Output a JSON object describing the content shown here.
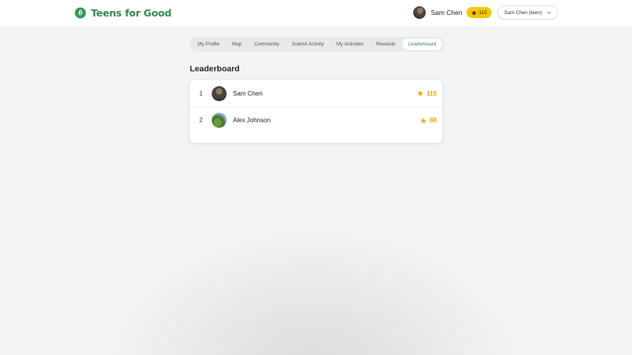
{
  "header": {
    "brand_name": "Teens for Good",
    "user_name": "Sam Chen",
    "user_points": "115",
    "user_selector_value": "Sam Chen (teen)"
  },
  "nav": {
    "tabs": [
      {
        "label": "My Profile"
      },
      {
        "label": "Map"
      },
      {
        "label": "Community"
      },
      {
        "label": "Submit Activity"
      },
      {
        "label": "My Activities"
      },
      {
        "label": "Rewards"
      },
      {
        "label": "Leaderboard"
      }
    ],
    "active_tab": "Leaderboard"
  },
  "page": {
    "title": "Leaderboard"
  },
  "leaderboard": {
    "entries": [
      {
        "rank": "1",
        "name": "Sam Chen",
        "points": "115"
      },
      {
        "rank": "2",
        "name": "Alex Johnson",
        "points": "88"
      }
    ]
  },
  "colors": {
    "brand_green": "#2f8a4e",
    "points_gold": "#f7c600",
    "points_text": "#e2a400"
  },
  "icons": {
    "brand": "leaf-icon",
    "points": "star-icon",
    "select": "chevron-down-icon"
  }
}
